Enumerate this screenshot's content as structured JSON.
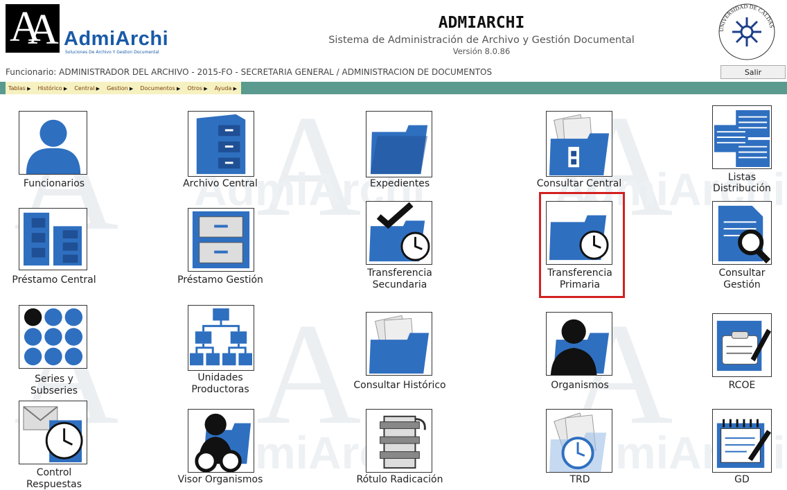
{
  "header": {
    "logo_text": "AdmiArchi",
    "logo_sub": "Soluciones De Archivo Y Gestion Documental",
    "title": "ADMIARCHI",
    "subtitle": "Sistema de Administración de Archivo y Gestión Documental",
    "version": "Versión 8.0.86",
    "seal_text": "UNIVERSIDAD DE CALDAS",
    "funcionario": "Funcionario: ADMINISTRADOR DEL ARCHIVO - 2015-FO - SECRETARIA GENERAL / ADMINISTRACION DE DOCUMENTOS",
    "logout_label": "Salir"
  },
  "menu": [
    "Tablas",
    "Histórico",
    "Central",
    "Gestion",
    "Documentos",
    "Otros",
    "Ayuda"
  ],
  "tiles": {
    "funcionarios": "Funcionarios",
    "archivo_central": "Archivo Central",
    "expedientes": "Expedientes",
    "consultar_central": "Consultar Central",
    "listas_l1": "Listas",
    "listas_l2": "Distribución",
    "prestamo_central": "Préstamo Central",
    "prestamo_gestion": "Préstamo Gestión",
    "ts_l1": "Transferencia",
    "ts_l2": "Secundaria",
    "tp_l1": "Transferencia",
    "tp_l2": "Primaria",
    "cg_l1": "Consultar",
    "cg_l2": "Gestión",
    "series_l1": "Series y",
    "series_l2": "Subseries",
    "unidades_l1": "Unidades",
    "unidades_l2": "Productoras",
    "consultar_historico": "Consultar Histórico",
    "organismos": "Organismos",
    "rcoe": "RCOE",
    "control_l1": "Control",
    "control_l2": "Respuestas",
    "visor_organismos": "Visor Organismos",
    "rotulo_radicacion": "Rótulo Radicación",
    "trd": "TRD",
    "gd": "GD"
  },
  "colors": {
    "accent": "#2f6fc0",
    "menubar": "#5a9a8f",
    "highlight": "#d32020"
  },
  "watermark_text": "AdmiArchi"
}
